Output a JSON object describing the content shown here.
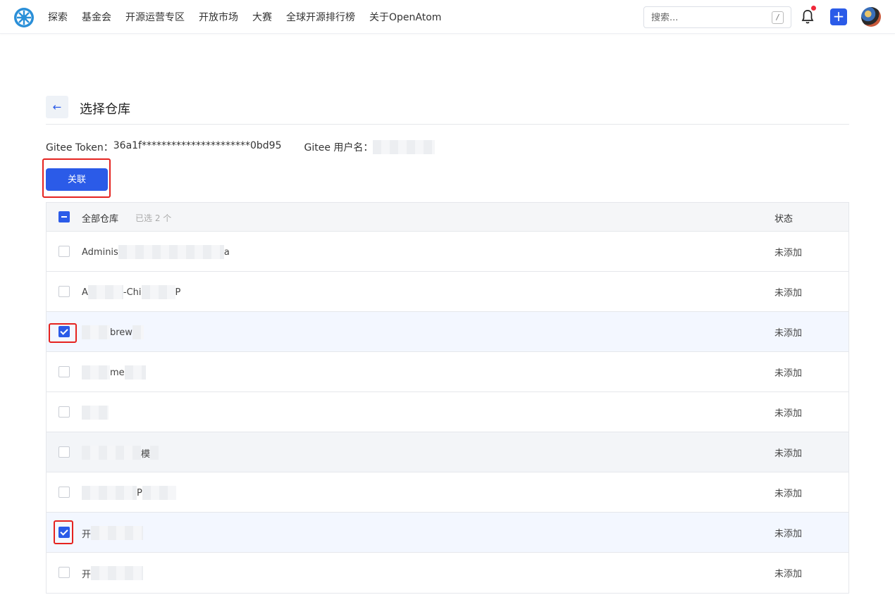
{
  "nav": {
    "items": [
      "探索",
      "基金会",
      "开源运营专区",
      "开放市场",
      "大赛",
      "全球开源排行榜",
      "关于OpenAtom"
    ],
    "search_placeholder": "搜索...",
    "search_shortcut": "/"
  },
  "page": {
    "back_icon": "←",
    "title": "选择仓库",
    "token_label": "Gitee Token：",
    "token_value": "36a1f**********************0bd95",
    "username_label": "Gitee 用户名："
  },
  "actions": {
    "link_label": "关联"
  },
  "table": {
    "header_name": "全部仓库",
    "selected_count": "已选 2 个",
    "header_status": "状态",
    "rows": [
      {
        "name": "Adminis",
        "name_suffix": "a",
        "status": "未添加",
        "checked": false
      },
      {
        "name": "A",
        "name_suffix": "-Chi",
        "name_tail": "P",
        "status": "未添加",
        "checked": false
      },
      {
        "name": "",
        "name_suffix": "brew",
        "status": "未添加",
        "checked": true
      },
      {
        "name": "",
        "name_suffix": "me",
        "status": "未添加",
        "checked": false
      },
      {
        "name": "",
        "name_suffix": "",
        "status": "未添加",
        "checked": false
      },
      {
        "name": "",
        "name_suffix": "模",
        "status": "未添加",
        "checked": false
      },
      {
        "name": "",
        "name_suffix": "P",
        "status": "未添加",
        "checked": false
      },
      {
        "name": "开",
        "name_suffix": "",
        "status": "未添加",
        "checked": true
      },
      {
        "name": "开",
        "name_suffix": "",
        "status": "未添加",
        "checked": false
      }
    ]
  },
  "colors": {
    "primary": "#2b5be8",
    "annotation": "#e5231f",
    "notify_dot": "#f0283a"
  }
}
